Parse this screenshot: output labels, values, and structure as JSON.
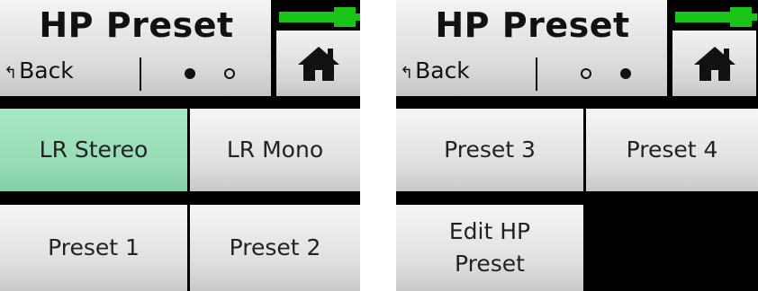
{
  "screens": [
    {
      "title": "HP Preset",
      "back_label": "Back",
      "back_arrow": "↰",
      "page_indicator": {
        "pages": 2,
        "current": 1
      },
      "battery_color": "#17c417",
      "home_icon": "home-icon",
      "buttons": [
        {
          "label": "LR Stereo",
          "active": true
        },
        {
          "label": "LR Mono",
          "active": false
        },
        {
          "label": "Preset 1",
          "active": false
        },
        {
          "label": "Preset 2",
          "active": false
        }
      ]
    },
    {
      "title": "HP Preset",
      "back_label": "Back",
      "back_arrow": "↰",
      "page_indicator": {
        "pages": 2,
        "current": 2
      },
      "battery_color": "#17c417",
      "home_icon": "home-icon",
      "buttons": [
        {
          "label": "Preset 3",
          "active": false
        },
        {
          "label": "Preset 4",
          "active": false
        },
        {
          "label": "Edit HP Preset",
          "active": false
        }
      ]
    }
  ],
  "colors": {
    "active_button": "#95dbb6",
    "button": "#dedede",
    "background": "#000000"
  }
}
